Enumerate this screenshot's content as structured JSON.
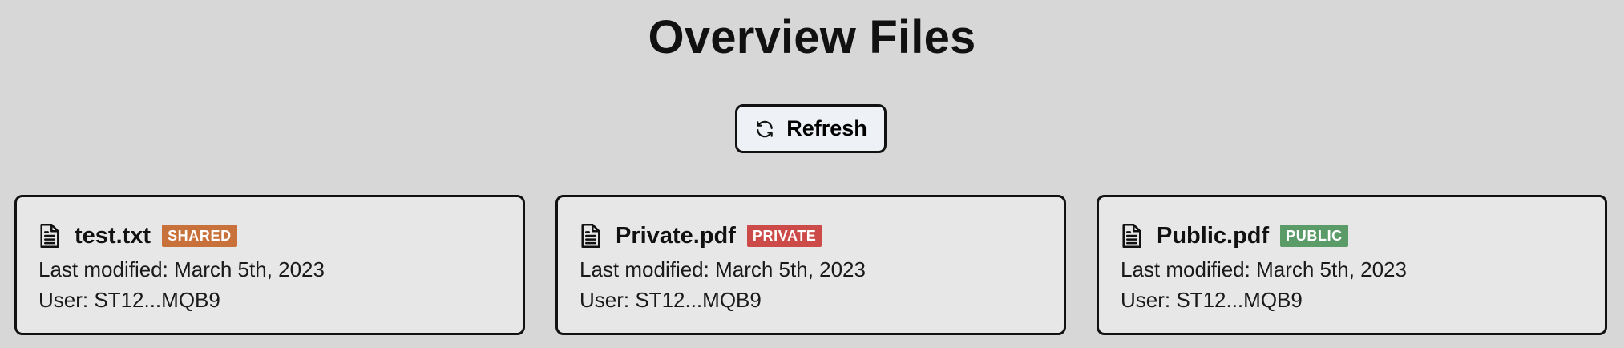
{
  "page": {
    "title": "Overview Files"
  },
  "toolbar": {
    "refresh_label": "Refresh",
    "refresh_icon": "refresh-icon"
  },
  "files": [
    {
      "name": "test.txt",
      "badge": "SHARED",
      "badge_color": "#c8713a",
      "modified_label": "Last modified: March 5th, 2023",
      "user_label": "User: ST12...MQB9",
      "icon": "file-text-icon"
    },
    {
      "name": "Private.pdf",
      "badge": "PRIVATE",
      "badge_color": "#cc4a48",
      "modified_label": "Last modified: March 5th, 2023",
      "user_label": "User: ST12...MQB9",
      "icon": "file-text-icon"
    },
    {
      "name": "Public.pdf",
      "badge": "PUBLIC",
      "badge_color": "#5a9b68",
      "modified_label": "Last modified: March 5th, 2023",
      "user_label": "User: ST12...MQB9",
      "icon": "file-text-icon"
    }
  ],
  "colors": {
    "background": "#d7d7d7",
    "card_background": "#e7e7e7",
    "button_background": "#eef2f6",
    "border": "#111111"
  }
}
